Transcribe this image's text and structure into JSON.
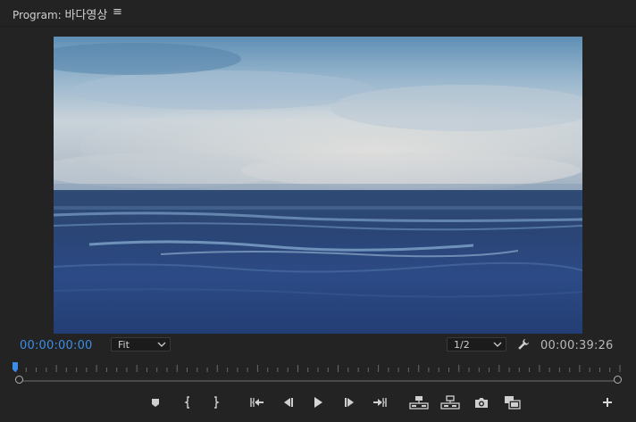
{
  "panel": {
    "title_prefix": "Program:",
    "sequence_name": "바다영상",
    "menu_glyph": "≡"
  },
  "timecode": {
    "current": "00:00:00:00",
    "duration": "00:00:39:26"
  },
  "zoom": {
    "selected": "Fit"
  },
  "resolution": {
    "selected": "1/2"
  },
  "colors": {
    "background": "#232323",
    "timecode_accent": "#3b8ee8",
    "icon": "#cfcfcf"
  },
  "playback": {
    "position_fraction": 0.0
  },
  "transport_buttons": [
    {
      "name": "add-marker-button",
      "icon": "marker-icon"
    },
    {
      "name": "mark-in-button",
      "icon": "mark-in-icon"
    },
    {
      "name": "mark-out-button",
      "icon": "mark-out-icon"
    },
    {
      "name": "go-to-in-button",
      "icon": "go-to-in-icon"
    },
    {
      "name": "step-back-button",
      "icon": "step-back-icon"
    },
    {
      "name": "play-button",
      "icon": "play-icon"
    },
    {
      "name": "step-forward-button",
      "icon": "step-forward-icon"
    },
    {
      "name": "go-to-out-button",
      "icon": "go-to-out-icon"
    },
    {
      "name": "lift-button",
      "icon": "lift-icon"
    },
    {
      "name": "extract-button",
      "icon": "extract-icon"
    },
    {
      "name": "export-frame-button",
      "icon": "camera-icon"
    },
    {
      "name": "comparison-view-button",
      "icon": "comparison-view-icon"
    },
    {
      "name": "button-editor-button",
      "icon": "plus-icon"
    }
  ]
}
